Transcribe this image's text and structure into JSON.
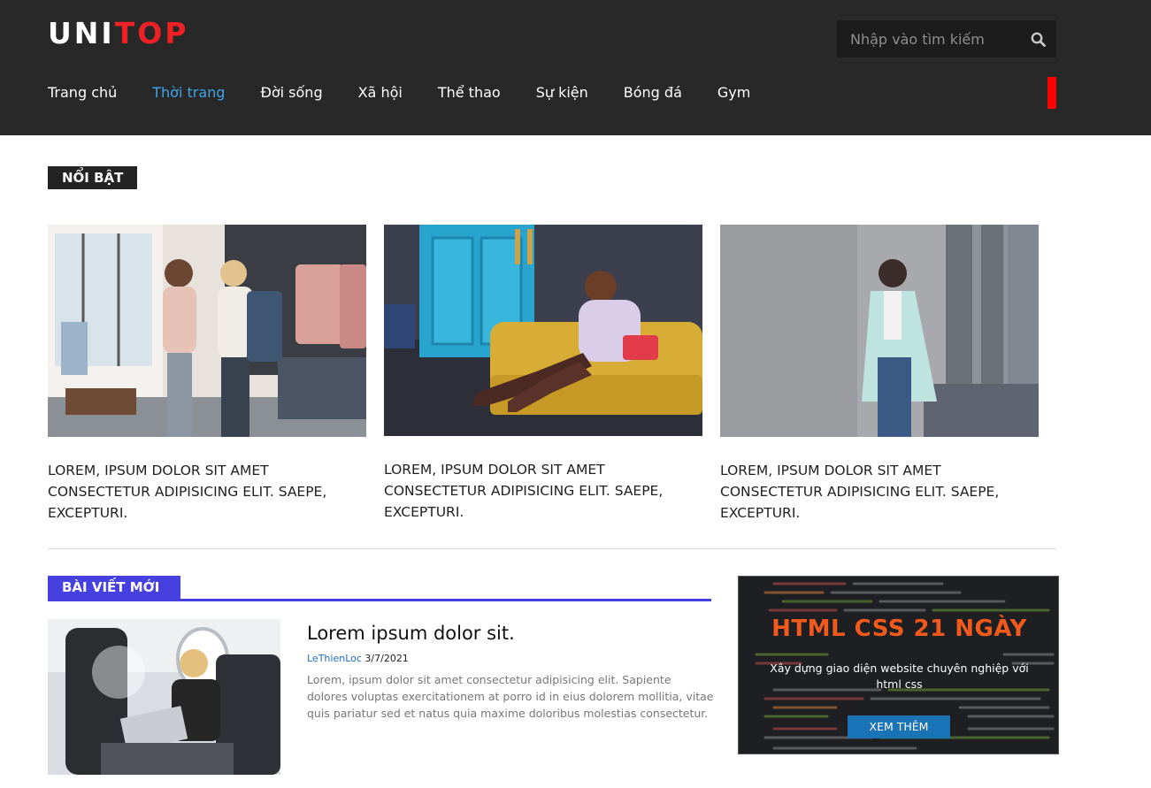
{
  "header": {
    "logo": {
      "part1": "UNI",
      "part2": "TOP"
    },
    "search": {
      "placeholder": "Nhập vào tìm kiếm",
      "icon": "search-icon"
    },
    "nav": [
      {
        "label": "Trang chủ",
        "active": false
      },
      {
        "label": "Thời trang",
        "active": true
      },
      {
        "label": "Đời sống",
        "active": false
      },
      {
        "label": "Xã hội",
        "active": false
      },
      {
        "label": "Thể thao",
        "active": false
      },
      {
        "label": "Sự kiện",
        "active": false
      },
      {
        "label": "Bóng đá",
        "active": false
      },
      {
        "label": "Gym",
        "active": false
      }
    ]
  },
  "featured": {
    "label": "NỔI BẬT",
    "items": [
      {
        "title": "LOREM, IPSUM DOLOR SIT AMET CONSECTETUR ADIPISICING ELIT. SAEPE, EXCEPTURI."
      },
      {
        "title": "LOREM, IPSUM DOLOR SIT AMET CONSECTETUR ADIPISICING ELIT. SAEPE, EXCEPTURI."
      },
      {
        "title": "LOREM, IPSUM DOLOR SIT AMET CONSECTETUR ADIPISICING ELIT. SAEPE, EXCEPTURI."
      }
    ]
  },
  "new_posts": {
    "label": "BÀI VIẾT MỚI",
    "post": {
      "title": "Lorem ipsum dolor sit.",
      "author": "LeThienLoc",
      "date": "3/7/2021",
      "excerpt": "Lorem, ipsum dolor sit amet consectetur adipisicing elit. Sapiente dolores voluptas exercitationem at porro id in eius dolorem mollitia, vitae quis pariatur sed et natus quia maxime doloribus molestias consectetur."
    }
  },
  "banner": {
    "title": "HTML CSS 21 NGÀY",
    "subtitle": "Xây dựng giao diện website chuyên nghiệp với html css",
    "button": "XEM THÊM"
  },
  "colors": {
    "header_bg": "#282828",
    "logo_accent": "#ee2127",
    "nav_active": "#3ea5e8",
    "tag_blue": "#4740e0",
    "banner_title": "#f15a1c",
    "banner_button": "#1a73b4"
  }
}
